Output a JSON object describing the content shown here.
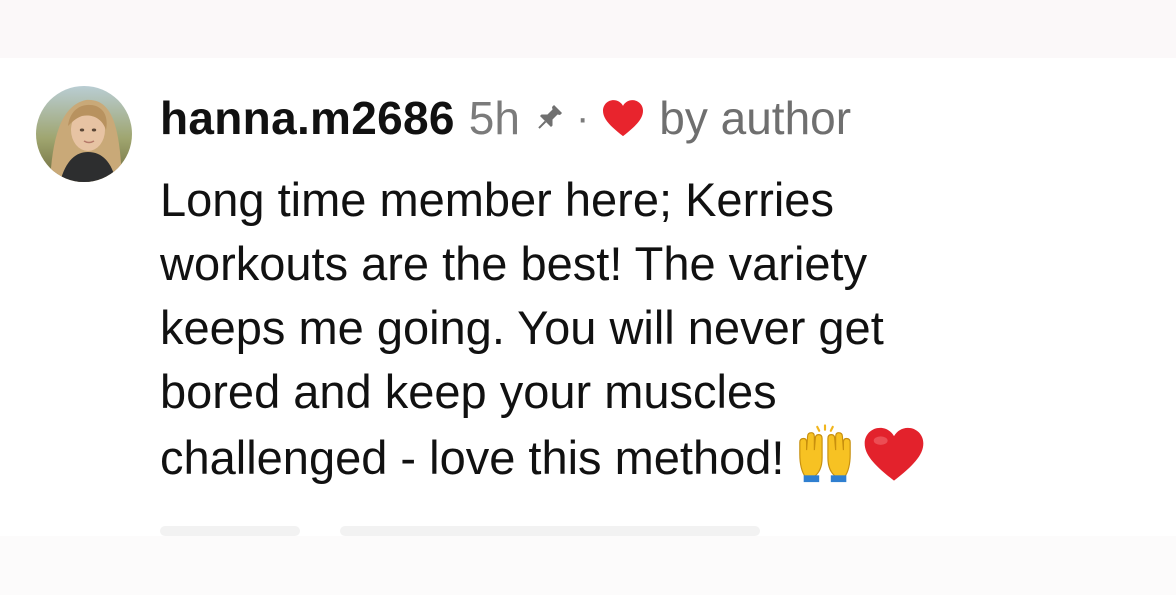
{
  "comment": {
    "username": "hanna.m2686",
    "timestamp": "5h",
    "pinned_icon": "pin-icon",
    "separator": "·",
    "liked_icon": "heart-icon",
    "liked_by": "by author",
    "text_lines": [
      "Long time member here; Kerries",
      "workouts are the best! The variety",
      "keeps me going. You will never get",
      "bored and keep your muscles",
      "challenged - love this method!"
    ],
    "trailing_emojis": [
      "raising-hands-icon",
      "red-heart-icon"
    ]
  },
  "colors": {
    "heart": "#e8242d",
    "username": "#111111",
    "meta": "#7b7b7b"
  }
}
